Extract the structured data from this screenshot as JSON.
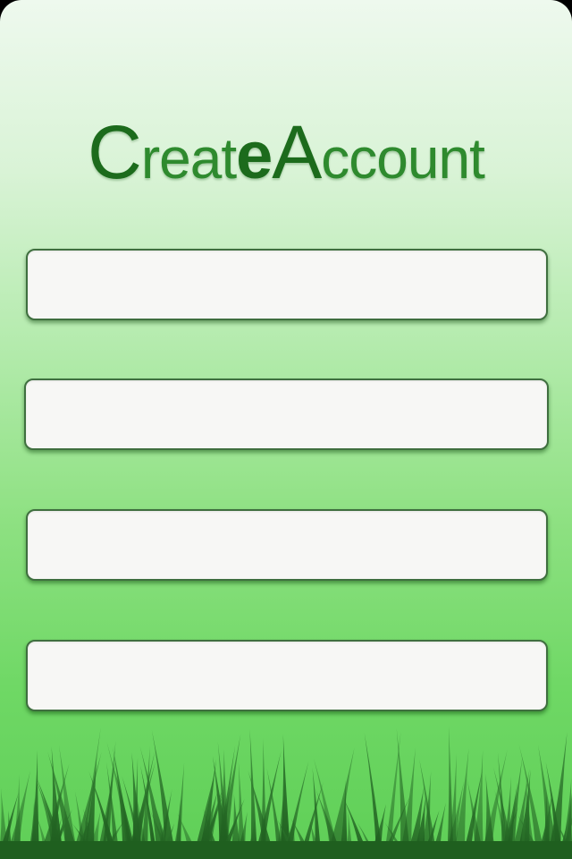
{
  "header": {
    "title_part1_initial": "C",
    "title_part1_rest": "reat",
    "title_part2_letter": "e",
    "title_part3_initial": "A",
    "title_part3_rest": "ccount"
  },
  "form": {
    "fields": [
      {
        "value": "",
        "placeholder": ""
      },
      {
        "value": "",
        "placeholder": ""
      },
      {
        "value": "",
        "placeholder": ""
      },
      {
        "value": "",
        "placeholder": ""
      }
    ]
  },
  "decor": {
    "grass_icon": "grass-decoration",
    "accent_color": "#1c6b1c",
    "background_color": "#6fd865"
  }
}
